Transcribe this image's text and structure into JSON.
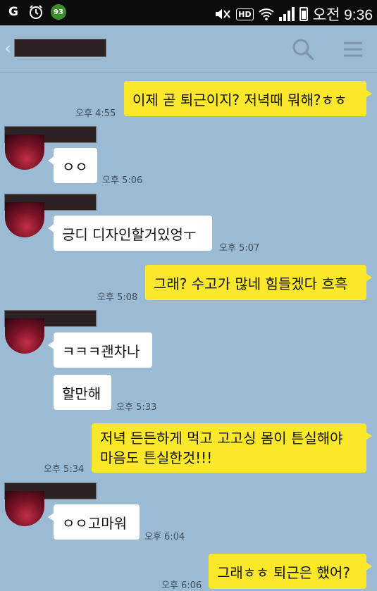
{
  "status_bar": {
    "carrier_icon": "G",
    "alarm_icon": "alarm-clock",
    "badge_value": "93",
    "hd_label": "HD",
    "ampm": "오전",
    "time": "9:36"
  },
  "header": {
    "back_icon": "‹",
    "search_icon": "search",
    "menu_icon": "hamburger-menu"
  },
  "messages": {
    "m1": {
      "text": "이제 곧 퇴근이지? 저녁때 뭐해?ㅎㅎ",
      "time": "오후 4:55"
    },
    "m2": {
      "text": "ㅇㅇ",
      "time": "오후 5:06"
    },
    "m3": {
      "text": "긍디 디자인할거있엉ㅜ",
      "time": "오후 5:07"
    },
    "m4": {
      "text": "그래? 수고가 많네 힘들겠다 흐흑",
      "time": "오후 5:08"
    },
    "m5": {
      "text": "ㅋㅋㅋ괜차나"
    },
    "m6": {
      "text": "할만해",
      "time": "오후 5:33"
    },
    "m7": {
      "line1": "저녁 든든하게 먹고 고고싱 몸이 튼실해야",
      "line2": "마음도 튼실한것!!!",
      "time": "오후 5:34"
    },
    "m8": {
      "text": "ㅇㅇ고마워",
      "time": "오후 6:04"
    },
    "m9": {
      "text": "그래ㅎㅎ 퇴근은 했어?",
      "time": "오후 6:06"
    }
  },
  "colors": {
    "background": "#9bbbd4",
    "my_bubble": "#fce82a",
    "their_bubble": "#ffffff",
    "status_bar": "#0c0c0c"
  }
}
